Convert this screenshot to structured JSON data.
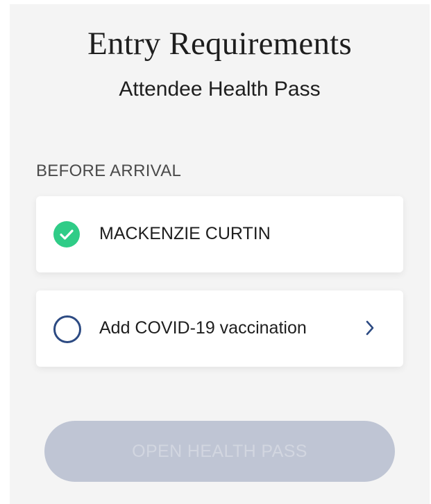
{
  "header": {
    "title": "Entry Requirements",
    "subtitle": "Attendee Health Pass"
  },
  "section": {
    "label": "BEFORE ARRIVAL"
  },
  "requirements": [
    {
      "label": "MACKENZIE CURTIN",
      "status": "complete",
      "icon": "check-circle-icon"
    },
    {
      "label": "Add COVID-19 vaccination",
      "status": "incomplete",
      "icon": "empty-circle-icon",
      "action_icon": "chevron-right-icon"
    }
  ],
  "actions": {
    "open_label": "OPEN HEALTH PASS",
    "open_disabled": true
  },
  "colors": {
    "background": "#f4f4f4",
    "success": "#2fcc87",
    "accent": "#2c4a82",
    "button_disabled": "#bfc5d4"
  }
}
